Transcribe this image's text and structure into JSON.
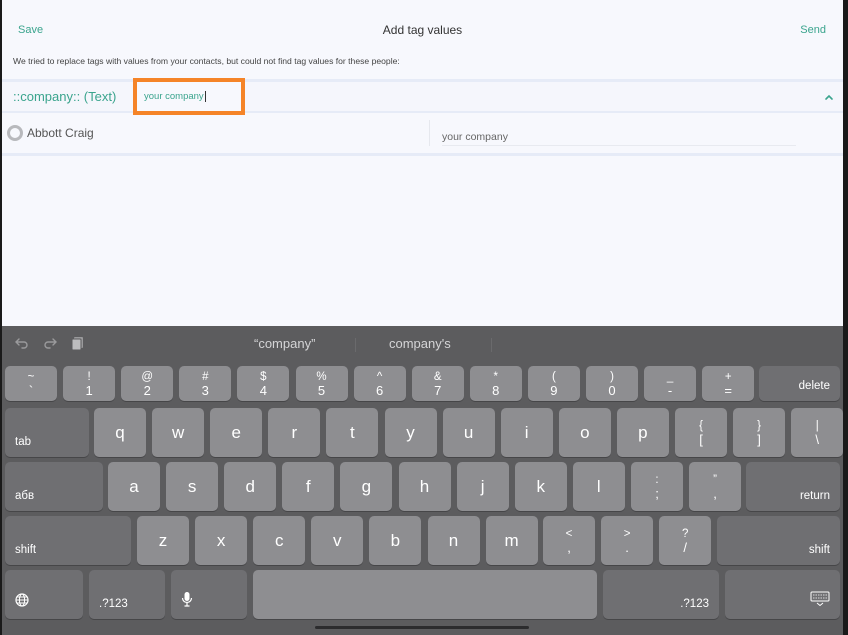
{
  "navbar": {
    "save_label": "Save",
    "title": "Add tag values",
    "send_label": "Send"
  },
  "info_text": "We tried to replace tags with values from your contacts, but could not find tag values for these people:",
  "tag": {
    "label": "::company:: (Text)",
    "input_value": "your company",
    "expanded": true
  },
  "contacts": [
    {
      "name": "Abbott Craig",
      "value": "your company"
    }
  ],
  "colors": {
    "accent": "#3aa48d",
    "highlight": "#f58428",
    "keyboard_bg": "#5c5c5e",
    "key_light": "#8e8e91",
    "key_dark": "#6f6f72"
  },
  "keyboard": {
    "toolbar": {
      "icons": [
        "undo-icon",
        "redo-icon",
        "paste-icon"
      ],
      "suggestions": [
        "“company”",
        "company's"
      ]
    },
    "row1": [
      {
        "top": "~",
        "bot": "`"
      },
      {
        "top": "!",
        "bot": "1"
      },
      {
        "top": "@",
        "bot": "2"
      },
      {
        "top": "#",
        "bot": "3"
      },
      {
        "top": "$",
        "bot": "4"
      },
      {
        "top": "%",
        "bot": "5"
      },
      {
        "top": "^",
        "bot": "6"
      },
      {
        "top": "&",
        "bot": "7"
      },
      {
        "top": "*",
        "bot": "8"
      },
      {
        "top": "(",
        "bot": "9"
      },
      {
        "top": ")",
        "bot": "0"
      },
      {
        "top": "_",
        "bot": "-"
      },
      {
        "top": "+",
        "bot": "="
      }
    ],
    "delete_label": "delete",
    "tab_label": "tab",
    "row2": [
      "q",
      "w",
      "e",
      "r",
      "t",
      "y",
      "u",
      "i",
      "o",
      "p"
    ],
    "row2_sym": [
      {
        "top": "{",
        "bot": "["
      },
      {
        "top": "}",
        "bot": "]"
      },
      {
        "top": "|",
        "bot": "\\"
      }
    ],
    "lang_label": "абв",
    "row3": [
      "a",
      "s",
      "d",
      "f",
      "g",
      "h",
      "j",
      "k",
      "l"
    ],
    "row3_sym": [
      {
        "top": ":",
        "bot": ";"
      },
      {
        "top": "”",
        "bot": ","
      }
    ],
    "return_label": "return",
    "shift_label": "shift",
    "row4": [
      "z",
      "x",
      "c",
      "v",
      "b",
      "n",
      "m"
    ],
    "row4_sym": [
      {
        "top": "<",
        "bot": ","
      },
      {
        "top": ">",
        "bot": "."
      },
      {
        "top": "?",
        "bot": "/"
      }
    ],
    "numbers_label": ".?123"
  }
}
